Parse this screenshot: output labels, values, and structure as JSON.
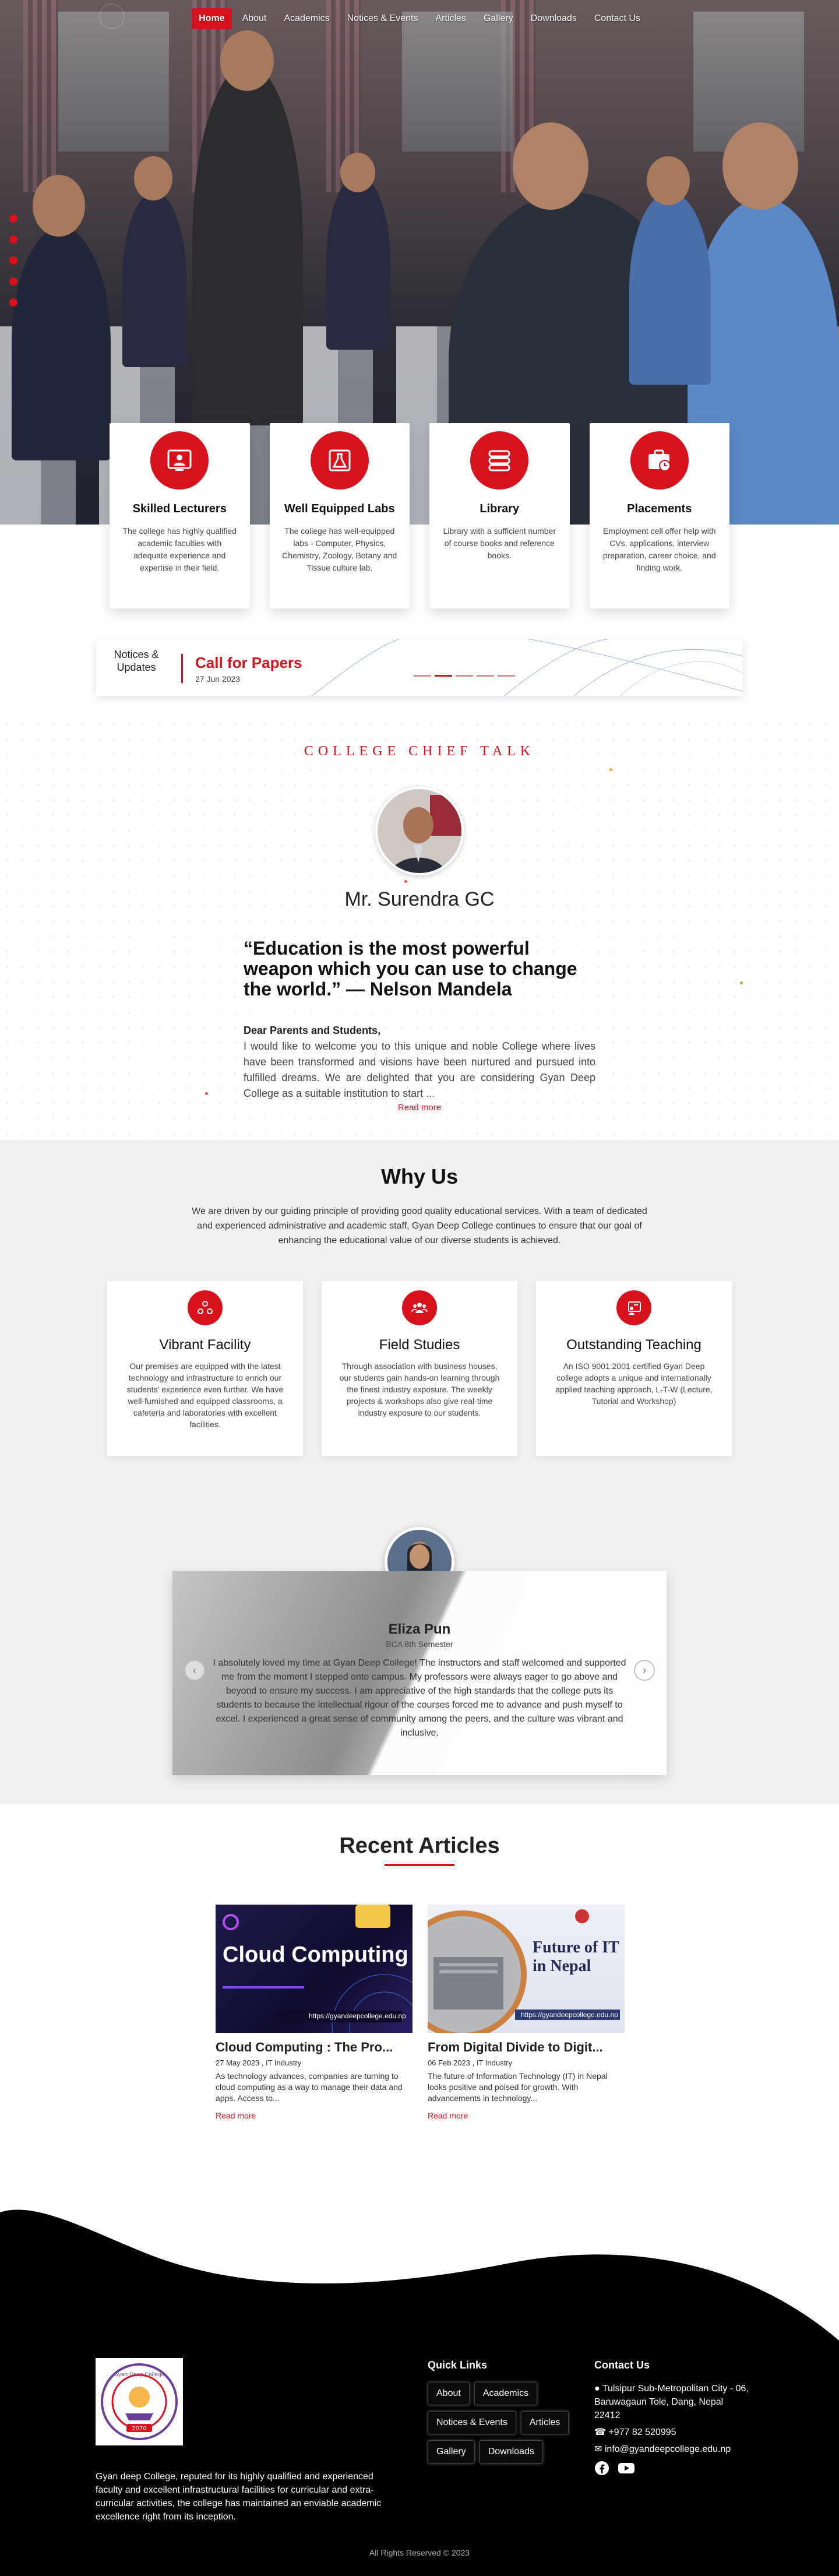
{
  "nav": {
    "items": [
      "Home",
      "About",
      "Academics",
      "Notices & Events",
      "Articles",
      "Gallery",
      "Downloads",
      "Contact Us"
    ],
    "active": "Home"
  },
  "features": [
    {
      "icon": "lecturer-icon",
      "title": "Skilled Lecturers",
      "text": "The college has highly qualified academic faculties with adequate experience and expertise in their field."
    },
    {
      "icon": "flask-icon",
      "title": "Well Equipped Labs",
      "text": "The college has well-equipped labs - Computer, Physics, Chemistry, Zoology, Botany and Tissue culture lab."
    },
    {
      "icon": "books-icon",
      "title": "Library",
      "text": "Library with a sufficient number of course books and reference books."
    },
    {
      "icon": "briefcase-clock-icon",
      "title": "Placements",
      "text": "Employment cell offer help with CVs, applications, interview preparation, career choice, and finding work."
    }
  ],
  "notices": {
    "label": "Notices & Updates",
    "title": "Call for Papers",
    "date": "27 Jun 2023"
  },
  "chief": {
    "heading": "COLLEGE CHIEF TALK",
    "name": "Mr. Surendra GC",
    "quote": "“Education is the most powerful weapon which you can use to change the world.” — Nelson Mandela",
    "greeting": "Dear Parents and Students,",
    "message": "I would like to welcome you to this unique and noble College where lives have been transformed and visions have been nurtured and pursued into fulfilled dreams. We are delighted that you are considering Gyan Deep College as a suitable institution to start ...",
    "read_more": "Read more"
  },
  "why": {
    "title": "Why Us",
    "lead": "We are driven by our guiding principle of providing good quality educational services. With a team of dedicated and experienced administrative and academic staff, Gyan Deep College continues to ensure that our goal of enhancing the educational value of our diverse students is achieved.",
    "cards": [
      {
        "icon": "network-icon",
        "title": "Vibrant Facility",
        "text": "Our premises are equipped with the latest technology and infrastructure to enrich our students' experience even further. We have well-furnished and equipped classrooms, a cafeteria and laboratories with excellent facilities."
      },
      {
        "icon": "group-icon",
        "title": "Field Studies",
        "text": "Through association with business houses, our students gain hands-on learning through the finest industry exposure. The weekly projects & workshops also give real-time industry exposure to our students."
      },
      {
        "icon": "teaching-icon",
        "title": "Outstanding Teaching",
        "text": "An ISO 9001:2001 certified Gyan Deep college adopts a unique and internationally applied teaching approach, L-T-W (Lecture, Tutorial and Workshop)"
      }
    ]
  },
  "testimonial": {
    "name": "Eliza Pun",
    "role": "BCA 8th Semester",
    "text": "I absolutely loved my time at Gyan Deep College! The instructors and staff welcomed and supported me from the moment I stepped onto campus. My professors were always eager to go above and beyond to ensure my success. I am appreciative of the high standards that the college puts its students to because the intellectual rigour of the courses forced me to advance and push myself to excel. I experienced a great sense of community among the peers, and the culture was vibrant and inclusive."
  },
  "articles": {
    "title": "Recent Articles",
    "items": [
      {
        "title": "Cloud Computing : The Pro...",
        "meta": "27 May 2023 , IT Industry",
        "excerpt": "As technology advances, companies are turning to cloud computing as a way to manage their data and apps. Access to...",
        "read_more": "Read more",
        "image_text": "Cloud Computing",
        "image_url": "https://gyandeepcollege.edu.np"
      },
      {
        "title": "From Digital Divide to Digit...",
        "meta": "06 Feb 2023 , IT Industry",
        "excerpt": "The future of Information Technology (IT) in Nepal looks positive and poised for growth. With advancements in technology...",
        "read_more": "Read more",
        "image_text": "Future of IT in Nepal",
        "image_url": "https://gyandeepcollege.edu.np"
      }
    ]
  },
  "footer": {
    "description": "Gyan deep College, reputed for its highly qualified and experienced faculty and excellent infrastructural facilities for curricular and extra-curricular activities, the college has maintained an enviable academic excellence right from its inception.",
    "logo_text": "Gyan Deep College",
    "logo_year": "2070",
    "quick_links_title": "Quick Links",
    "quick_links": [
      "About",
      "Academics",
      "Notices & Events",
      "Articles",
      "Gallery",
      "Downloads"
    ],
    "contact_title": "Contact Us",
    "address": "Tulsipur Sub-Metropolitan City - 06, Baruwagaun Tole, Dang, Nepal 22412",
    "phone": "+977 82 520995",
    "email": "info@gyandeepcollege.edu.np",
    "rights": "All Rights Reserved © 2023"
  },
  "colors": {
    "accent": "#d8121d",
    "dark": "#000000",
    "light_bg": "#f0f0f1"
  }
}
